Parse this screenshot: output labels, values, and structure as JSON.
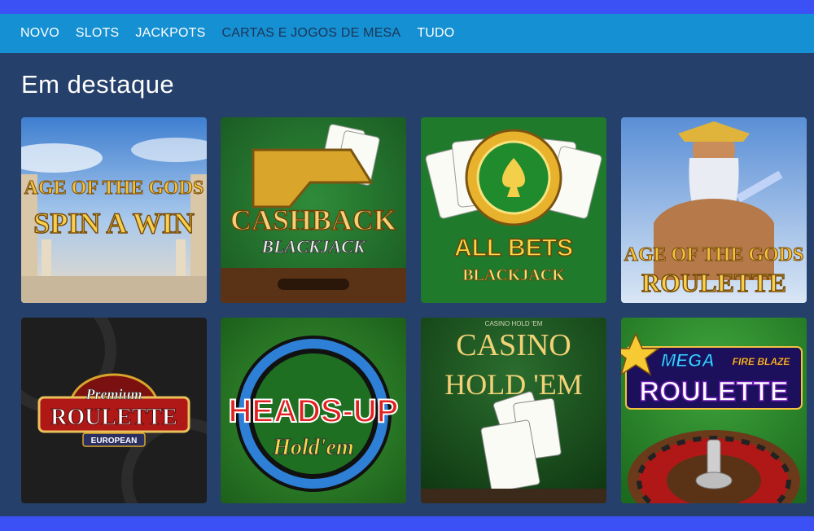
{
  "nav": {
    "items": [
      {
        "label": "NOVO"
      },
      {
        "label": "SLOTS"
      },
      {
        "label": "JACKPOTS"
      },
      {
        "label": "CARTAS E JOGOS DE MESA"
      },
      {
        "label": "TUDO"
      }
    ],
    "active_index": 3
  },
  "section": {
    "title": "Em destaque"
  },
  "games": [
    {
      "line1": "AGE OF THE GODS",
      "line2": "SPIN A WIN"
    },
    {
      "line1": "CASHBACK",
      "line2": "BLACKJACK"
    },
    {
      "line1": "ALL BETS",
      "line2": "BLACKJACK"
    },
    {
      "line1": "AGE OF THE GODS",
      "line2": "ROULETTE"
    },
    {
      "line1": "Premium",
      "line2": "ROULETTE",
      "line3": "EUROPEAN"
    },
    {
      "line1": "HEADS-UP",
      "line2": "Hold'em"
    },
    {
      "line1": "CASINO",
      "line2": "HOLD 'EM",
      "line3": "CASINO HOLD 'EM"
    },
    {
      "line1": "MEGA",
      "line2": "FIRE BLAZE",
      "line3": "ROULETTE"
    }
  ],
  "colors": {
    "page_bg": "#25406a",
    "nav_bg": "#1590d2",
    "strip": "#3b50f5"
  }
}
